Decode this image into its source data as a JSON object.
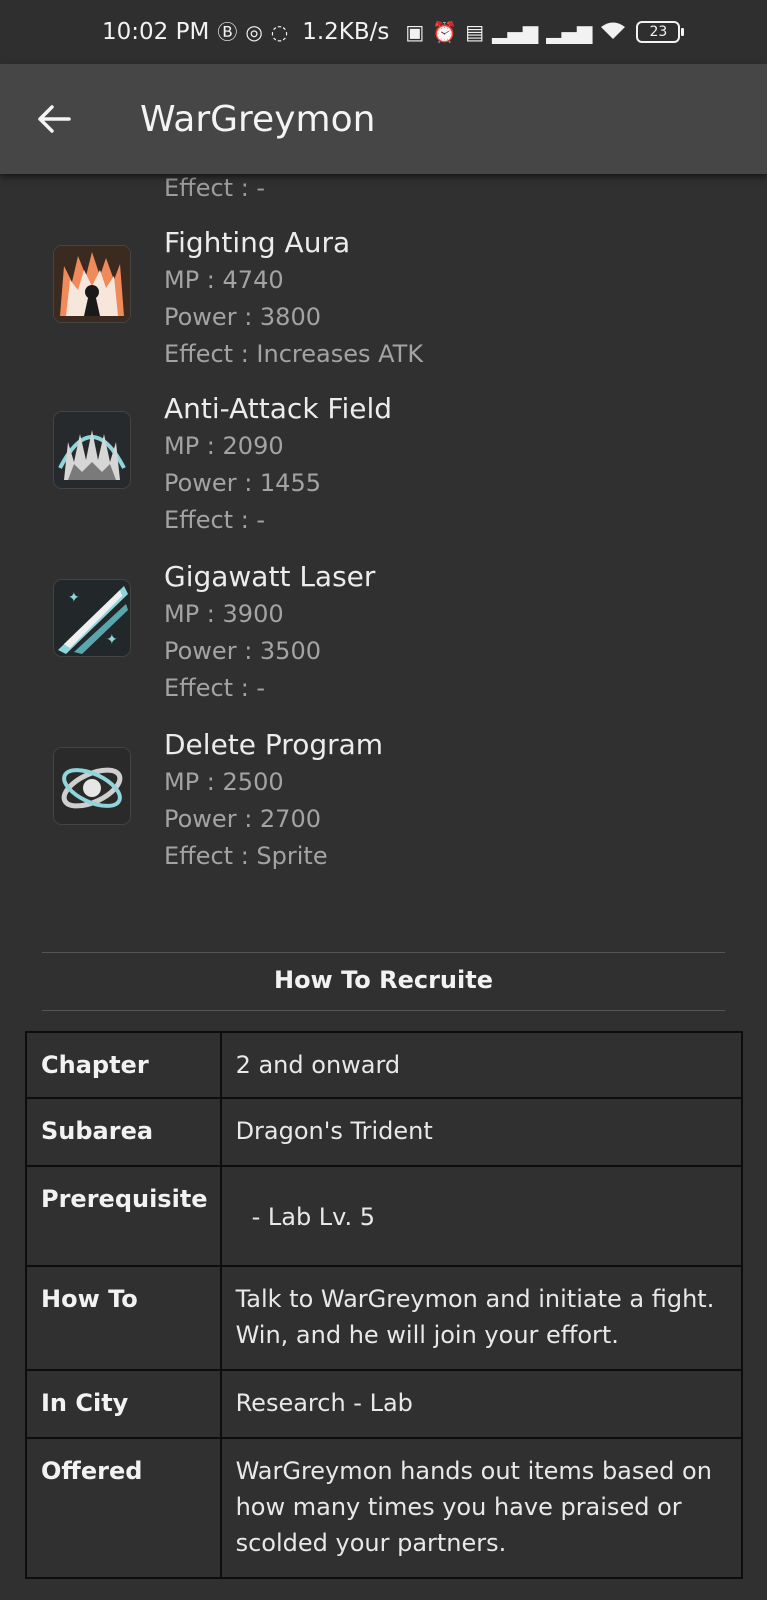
{
  "status_bar": {
    "time": "10:02 PM",
    "net_speed": "1.2KB/s",
    "battery": "23"
  },
  "app_bar": {
    "title": "WarGreymon"
  },
  "skills_partial_effect": "Effect : -",
  "skills": [
    {
      "name": "Fighting Aura",
      "mp": "MP : 4740",
      "power": "Power : 3800",
      "effect": "Effect : Increases ATK",
      "icon": "fighting-aura-icon"
    },
    {
      "name": "Anti-Attack Field",
      "mp": "MP : 2090",
      "power": "Power : 1455",
      "effect": "Effect : -",
      "icon": "anti-attack-field-icon"
    },
    {
      "name": "Gigawatt Laser",
      "mp": "MP : 3900",
      "power": "Power : 3500",
      "effect": "Effect : -",
      "icon": "gigawatt-laser-icon"
    },
    {
      "name": "Delete Program",
      "mp": "MP : 2500",
      "power": "Power : 2700",
      "effect": "Effect : Sprite",
      "icon": "delete-program-icon"
    }
  ],
  "recruit": {
    "title": "How To Recruite",
    "rows": [
      {
        "label": "Chapter",
        "value": "2 and onward"
      },
      {
        "label": "Subarea",
        "value": "Dragon's Trident"
      },
      {
        "label": "Prerequisite",
        "value": "- Lab Lv. 5"
      },
      {
        "label": "How To",
        "value": "Talk to WarGreymon and initiate a fight. Win, and he will join your effort."
      },
      {
        "label": "In City",
        "value": "Research - Lab"
      },
      {
        "label": "Offered",
        "value": "WarGreymon hands out items based on how many times you have praised or scolded your partners."
      }
    ]
  },
  "colors": {
    "background": "#303030",
    "app_bar": "#464646",
    "secondary_text": "#a3a3a3"
  }
}
